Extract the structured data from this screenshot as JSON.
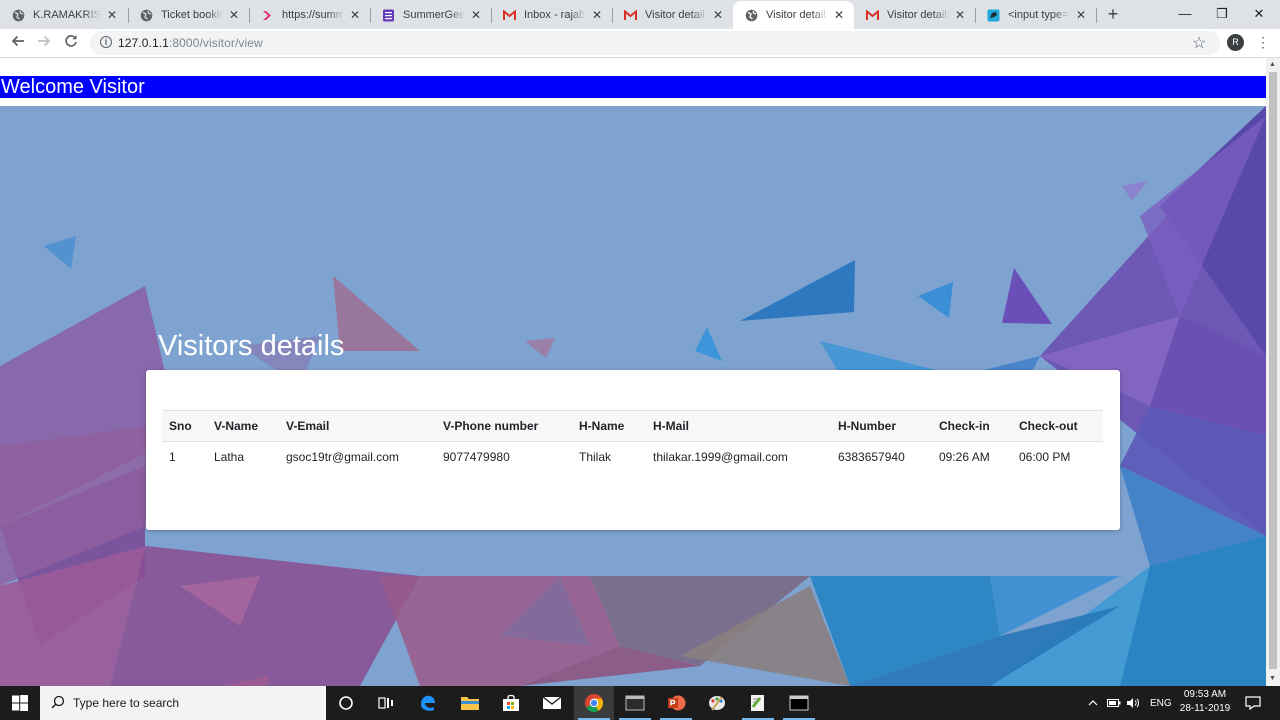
{
  "browser": {
    "tabs": [
      {
        "title": "K.RAMAKRISHNAN",
        "icon": "globe-icon",
        "active": false
      },
      {
        "title": "Ticket booking",
        "icon": "globe-icon",
        "active": false
      },
      {
        "title": "https://summergeeks",
        "icon": "arrow-favicon-icon",
        "active": false
      },
      {
        "title": "SummerGeeks",
        "icon": "forms-favicon-icon",
        "active": false
      },
      {
        "title": "Inbox - rajabadri",
        "icon": "gmail-icon",
        "active": false
      },
      {
        "title": "Visitor details - ",
        "icon": "gmail-icon",
        "active": false
      },
      {
        "title": "Visitor details",
        "icon": "globe-icon",
        "active": true
      },
      {
        "title": "Visitor details - ",
        "icon": "gmail-icon",
        "active": false
      },
      {
        "title": "<input type=\"te",
        "icon": "bird-favicon-icon",
        "active": false
      }
    ],
    "url_host": "127.0.1.1",
    "url_path": ":8000/visitor/view",
    "profile_initial": "R"
  },
  "page": {
    "welcome": "Welcome Visitor",
    "section_title": "Visitors details",
    "table": {
      "headers": [
        "Sno",
        "V-Name",
        "V-Email",
        "V-Phone number",
        "H-Name",
        "H-Mail",
        "H-Number",
        "Check-in",
        "Check-out"
      ],
      "rows": [
        [
          "1",
          "Latha",
          "gsoc19tr@gmail.com",
          "9077479980",
          "Thilak",
          "thilakar.1999@gmail.com",
          "6383657940",
          "09:26 AM",
          "06:00 PM"
        ]
      ]
    }
  },
  "taskbar": {
    "search_placeholder": "Type here to search",
    "language": "ENG",
    "time": "09:53 AM",
    "date": "28-11-2019"
  },
  "colors": {
    "welcome_bar": "#0000ff",
    "page_background": "#7ea3d0"
  }
}
